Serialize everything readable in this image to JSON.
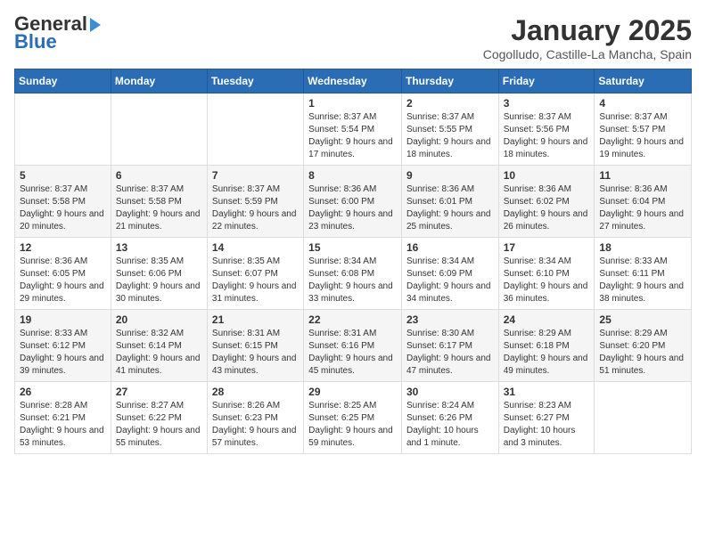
{
  "logo": {
    "line1": "General",
    "line2": "Blue"
  },
  "title": "January 2025",
  "subtitle": "Cogolludo, Castille-La Mancha, Spain",
  "days_of_week": [
    "Sunday",
    "Monday",
    "Tuesday",
    "Wednesday",
    "Thursday",
    "Friday",
    "Saturday"
  ],
  "weeks": [
    [
      {
        "day": "",
        "sunrise": "",
        "sunset": "",
        "daylight": ""
      },
      {
        "day": "",
        "sunrise": "",
        "sunset": "",
        "daylight": ""
      },
      {
        "day": "",
        "sunrise": "",
        "sunset": "",
        "daylight": ""
      },
      {
        "day": "1",
        "sunrise": "8:37 AM",
        "sunset": "5:54 PM",
        "daylight": "9 hours and 17 minutes."
      },
      {
        "day": "2",
        "sunrise": "8:37 AM",
        "sunset": "5:55 PM",
        "daylight": "9 hours and 18 minutes."
      },
      {
        "day": "3",
        "sunrise": "8:37 AM",
        "sunset": "5:56 PM",
        "daylight": "9 hours and 18 minutes."
      },
      {
        "day": "4",
        "sunrise": "8:37 AM",
        "sunset": "5:57 PM",
        "daylight": "9 hours and 19 minutes."
      }
    ],
    [
      {
        "day": "5",
        "sunrise": "8:37 AM",
        "sunset": "5:58 PM",
        "daylight": "9 hours and 20 minutes."
      },
      {
        "day": "6",
        "sunrise": "8:37 AM",
        "sunset": "5:58 PM",
        "daylight": "9 hours and 21 minutes."
      },
      {
        "day": "7",
        "sunrise": "8:37 AM",
        "sunset": "5:59 PM",
        "daylight": "9 hours and 22 minutes."
      },
      {
        "day": "8",
        "sunrise": "8:36 AM",
        "sunset": "6:00 PM",
        "daylight": "9 hours and 23 minutes."
      },
      {
        "day": "9",
        "sunrise": "8:36 AM",
        "sunset": "6:01 PM",
        "daylight": "9 hours and 25 minutes."
      },
      {
        "day": "10",
        "sunrise": "8:36 AM",
        "sunset": "6:02 PM",
        "daylight": "9 hours and 26 minutes."
      },
      {
        "day": "11",
        "sunrise": "8:36 AM",
        "sunset": "6:04 PM",
        "daylight": "9 hours and 27 minutes."
      }
    ],
    [
      {
        "day": "12",
        "sunrise": "8:36 AM",
        "sunset": "6:05 PM",
        "daylight": "9 hours and 29 minutes."
      },
      {
        "day": "13",
        "sunrise": "8:35 AM",
        "sunset": "6:06 PM",
        "daylight": "9 hours and 30 minutes."
      },
      {
        "day": "14",
        "sunrise": "8:35 AM",
        "sunset": "6:07 PM",
        "daylight": "9 hours and 31 minutes."
      },
      {
        "day": "15",
        "sunrise": "8:34 AM",
        "sunset": "6:08 PM",
        "daylight": "9 hours and 33 minutes."
      },
      {
        "day": "16",
        "sunrise": "8:34 AM",
        "sunset": "6:09 PM",
        "daylight": "9 hours and 34 minutes."
      },
      {
        "day": "17",
        "sunrise": "8:34 AM",
        "sunset": "6:10 PM",
        "daylight": "9 hours and 36 minutes."
      },
      {
        "day": "18",
        "sunrise": "8:33 AM",
        "sunset": "6:11 PM",
        "daylight": "9 hours and 38 minutes."
      }
    ],
    [
      {
        "day": "19",
        "sunrise": "8:33 AM",
        "sunset": "6:12 PM",
        "daylight": "9 hours and 39 minutes."
      },
      {
        "day": "20",
        "sunrise": "8:32 AM",
        "sunset": "6:14 PM",
        "daylight": "9 hours and 41 minutes."
      },
      {
        "day": "21",
        "sunrise": "8:31 AM",
        "sunset": "6:15 PM",
        "daylight": "9 hours and 43 minutes."
      },
      {
        "day": "22",
        "sunrise": "8:31 AM",
        "sunset": "6:16 PM",
        "daylight": "9 hours and 45 minutes."
      },
      {
        "day": "23",
        "sunrise": "8:30 AM",
        "sunset": "6:17 PM",
        "daylight": "9 hours and 47 minutes."
      },
      {
        "day": "24",
        "sunrise": "8:29 AM",
        "sunset": "6:18 PM",
        "daylight": "9 hours and 49 minutes."
      },
      {
        "day": "25",
        "sunrise": "8:29 AM",
        "sunset": "6:20 PM",
        "daylight": "9 hours and 51 minutes."
      }
    ],
    [
      {
        "day": "26",
        "sunrise": "8:28 AM",
        "sunset": "6:21 PM",
        "daylight": "9 hours and 53 minutes."
      },
      {
        "day": "27",
        "sunrise": "8:27 AM",
        "sunset": "6:22 PM",
        "daylight": "9 hours and 55 minutes."
      },
      {
        "day": "28",
        "sunrise": "8:26 AM",
        "sunset": "6:23 PM",
        "daylight": "9 hours and 57 minutes."
      },
      {
        "day": "29",
        "sunrise": "8:25 AM",
        "sunset": "6:25 PM",
        "daylight": "9 hours and 59 minutes."
      },
      {
        "day": "30",
        "sunrise": "8:24 AM",
        "sunset": "6:26 PM",
        "daylight": "10 hours and 1 minute."
      },
      {
        "day": "31",
        "sunrise": "8:23 AM",
        "sunset": "6:27 PM",
        "daylight": "10 hours and 3 minutes."
      },
      {
        "day": "",
        "sunrise": "",
        "sunset": "",
        "daylight": ""
      }
    ]
  ]
}
